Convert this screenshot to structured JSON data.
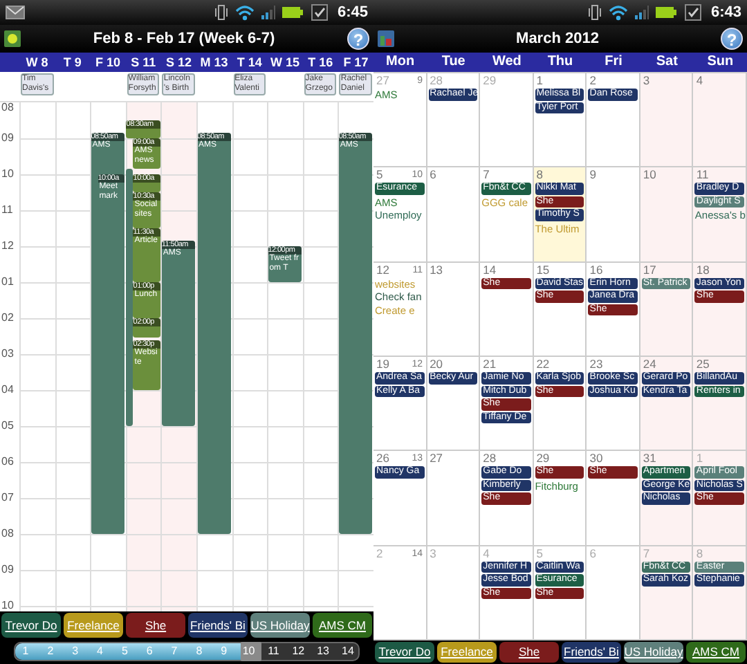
{
  "screens": [
    {
      "kind": "week",
      "status_bar": {
        "time": "6:45",
        "notifications": [
          {
            "kind": "mail"
          }
        ]
      },
      "title_bar": {
        "title": "Feb 8 - Feb 17 (Week 6-7)",
        "help": "?"
      },
      "week_view": {
        "days": [
          {
            "label": "W 8",
            "weekend": false,
            "all_day": [
              "Tim Davis's"
            ]
          },
          {
            "label": "T 9",
            "weekend": false
          },
          {
            "label": "F 10",
            "weekend": false,
            "events": [
              {
                "time": "08:50am",
                "title": "AMS",
                "color": "#4e7b6b"
              },
              {
                "time": "10:00a",
                "title": "Meet mark",
                "color": "#4e7b6b"
              }
            ]
          },
          {
            "label": "S 11",
            "weekend": true,
            "all_day": [
              "William Forsyth"
            ],
            "events": [
              {
                "time": "08:30am",
                "color": "#6b8f3c"
              },
              {
                "color": "#4e7b6b"
              },
              {
                "time": "09:00a",
                "title": "AMS news",
                "color": "#6b8f3c"
              },
              {
                "time": "10:00a",
                "color": "#6b8f3c"
              },
              {
                "time": "10:30a",
                "title": "Social sites",
                "color": "#6b8f3c"
              },
              {
                "time": "11:30a",
                "title": "Article",
                "color": "#6b8f3c"
              },
              {
                "time": "01:00p",
                "title": "Lunch",
                "color": "#6b8f3c"
              },
              {
                "time": "02:00p",
                "color": "#6b8f3c"
              },
              {
                "time": "02:30p",
                "title": "Website",
                "color": "#6b8f3c"
              }
            ]
          },
          {
            "label": "S 12",
            "weekend": true,
            "all_day": [
              "Lincoln 's Birth"
            ],
            "events": [
              {
                "time": "11:50am",
                "title": "AMS",
                "color": "#4e7b6b"
              }
            ]
          },
          {
            "label": "M 13",
            "weekend": false,
            "events": [
              {
                "time": "08:50am",
                "title": "AMS",
                "color": "#4e7b6b"
              }
            ]
          },
          {
            "label": "T 14",
            "weekend": false,
            "all_day": [
              "Eliza Valenti"
            ]
          },
          {
            "label": "W 15",
            "weekend": false,
            "events": [
              {
                "time": "12:00pm",
                "title": "Tweet from T",
                "color": "#4e7b6b"
              }
            ]
          },
          {
            "label": "T 16",
            "weekend": false,
            "all_day": [
              "Jake Grzego"
            ]
          },
          {
            "label": "F 17",
            "weekend": false,
            "all_day": [
              "Rachel Daniel"
            ],
            "events": [
              {
                "time": "08:50am",
                "title": "AMS",
                "color": "#4e7b6b"
              }
            ]
          }
        ],
        "hours": [
          "08",
          "09",
          "10",
          "11",
          "12",
          "01",
          "02",
          "03",
          "04",
          "05",
          "06",
          "07",
          "08",
          "09",
          "10"
        ]
      },
      "legend": [
        {
          "text": "Trevor Do",
          "color": "#1d5a45"
        },
        {
          "text": "Freelance",
          "color": "#b89a1c"
        },
        {
          "text": "She",
          "color": "#7b1c1c"
        },
        {
          "text": "Friends' Bi",
          "color": "#203566"
        },
        {
          "text": "US Holiday",
          "color": "#5f807c"
        },
        {
          "text": "AMS CM",
          "color": "#2f6a1a"
        }
      ],
      "slider": {
        "ticks": [
          "1",
          "2",
          "3",
          "4",
          "5",
          "6",
          "7",
          "8",
          "9",
          "10",
          "11",
          "12",
          "13",
          "14"
        ],
        "level": 0.692
      }
    },
    {
      "kind": "month",
      "status_bar": {
        "time": "6:43"
      },
      "title_bar": {
        "title": "March 2012",
        "help": "?"
      },
      "month_view": {
        "weekdays": [
          {
            "label": "Mon",
            "weekend": false
          },
          {
            "label": "Tue",
            "weekend": false
          },
          {
            "label": "Wed",
            "weekend": false
          },
          {
            "label": "Thu",
            "weekend": false
          },
          {
            "label": "Fri",
            "weekend": false
          },
          {
            "label": "Sat",
            "weekend": true
          },
          {
            "label": "Sun",
            "weekend": true
          }
        ],
        "weeks": [
          {
            "number": "9",
            "days": [
              {
                "date": "27",
                "other_month": true,
                "today": false,
                "events": [
                  {
                    "kind": "text",
                    "text": "AMS",
                    "color": "#2f7a3a"
                  }
                ]
              },
              {
                "date": "28",
                "other_month": true,
                "today": false,
                "events": [
                  {
                    "kind": "chip",
                    "text": "Rachael Je",
                    "color": "#203566"
                  }
                ]
              },
              {
                "date": "29",
                "other_month": true,
                "today": false
              },
              {
                "date": "1",
                "other_month": false,
                "today": false,
                "events": [
                  {
                    "kind": "chip",
                    "text": "Melissa Bl",
                    "color": "#203566"
                  },
                  {
                    "kind": "chip",
                    "text": "Tyler Port",
                    "color": "#203566"
                  }
                ]
              },
              {
                "date": "2",
                "other_month": false,
                "today": false,
                "events": [
                  {
                    "kind": "chip",
                    "text": "Dan Rose",
                    "color": "#203566"
                  }
                ]
              },
              {
                "date": "3",
                "other_month": false,
                "today": false
              },
              {
                "date": "4",
                "other_month": false,
                "today": false
              }
            ]
          },
          {
            "number": "10",
            "days": [
              {
                "date": "5",
                "other_month": false,
                "today": false,
                "events": [
                  {
                    "kind": "chip",
                    "text": "Esurance",
                    "color": "#1d5e45"
                  },
                  {
                    "kind": "text",
                    "text": "AMS",
                    "color": "#2f7a3a"
                  },
                  {
                    "kind": "text",
                    "text": "Unemploy",
                    "color": "#2f6a55"
                  }
                ]
              },
              {
                "date": "6",
                "other_month": false,
                "today": false
              },
              {
                "date": "7",
                "other_month": false,
                "today": false,
                "events": [
                  {
                    "kind": "chip",
                    "text": "Fbn&t CC",
                    "color": "#1d5e45"
                  },
                  {
                    "kind": "text",
                    "text": "GGG cale",
                    "color": "#c09a30"
                  }
                ]
              },
              {
                "date": "8",
                "other_month": false,
                "today": true,
                "events": [
                  {
                    "kind": "chip",
                    "text": "Nikki Mat",
                    "color": "#203566"
                  },
                  {
                    "kind": "chip",
                    "text": "She",
                    "color": "#7b1c1c"
                  },
                  {
                    "kind": "chip",
                    "text": "Timothy S",
                    "color": "#203566"
                  },
                  {
                    "kind": "text",
                    "text": "The Ultim",
                    "color": "#c09a30"
                  }
                ]
              },
              {
                "date": "9",
                "other_month": false,
                "today": false
              },
              {
                "date": "10",
                "other_month": false,
                "today": false
              },
              {
                "date": "11",
                "other_month": false,
                "today": false,
                "events": [
                  {
                    "kind": "chip",
                    "text": "Bradley D",
                    "color": "#203566"
                  },
                  {
                    "kind": "chip",
                    "text": "Daylight S",
                    "color": "#5a807a"
                  },
                  {
                    "kind": "text",
                    "text": "Anessa's b",
                    "color": "#2f6a55"
                  }
                ]
              }
            ]
          },
          {
            "number": "11",
            "days": [
              {
                "date": "12",
                "other_month": false,
                "today": false,
                "events": [
                  {
                    "kind": "text",
                    "text": "websites",
                    "color": "#c09a30"
                  },
                  {
                    "kind": "text",
                    "text": "Check fan",
                    "color": "#2f5a4a"
                  },
                  {
                    "kind": "text",
                    "text": "Create e",
                    "color": "#c09a30"
                  }
                ]
              },
              {
                "date": "13",
                "other_month": false,
                "today": false
              },
              {
                "date": "14",
                "other_month": false,
                "today": false,
                "events": [
                  {
                    "kind": "chip",
                    "text": "She",
                    "color": "#7b1c1c"
                  }
                ]
              },
              {
                "date": "15",
                "other_month": false,
                "today": false,
                "events": [
                  {
                    "kind": "chip",
                    "text": "David Stas",
                    "color": "#203566"
                  },
                  {
                    "kind": "chip",
                    "text": "She",
                    "color": "#7b1c1c"
                  }
                ]
              },
              {
                "date": "16",
                "other_month": false,
                "today": false,
                "events": [
                  {
                    "kind": "chip",
                    "text": "Erin Horn",
                    "color": "#203566"
                  },
                  {
                    "kind": "chip",
                    "text": "Janea Dra",
                    "color": "#203566"
                  },
                  {
                    "kind": "chip",
                    "text": "She",
                    "color": "#7b1c1c"
                  }
                ]
              },
              {
                "date": "17",
                "other_month": false,
                "today": false,
                "events": [
                  {
                    "kind": "chip",
                    "text": "St. Patrick",
                    "color": "#5a807a"
                  }
                ]
              },
              {
                "date": "18",
                "other_month": false,
                "today": false,
                "events": [
                  {
                    "kind": "chip",
                    "text": "Jason Yon",
                    "color": "#203566"
                  },
                  {
                    "kind": "chip",
                    "text": "She",
                    "color": "#7b1c1c"
                  }
                ]
              }
            ]
          },
          {
            "number": "12",
            "days": [
              {
                "date": "19",
                "other_month": false,
                "today": false,
                "events": [
                  {
                    "kind": "chip",
                    "text": "Andrea Sa",
                    "color": "#203566"
                  },
                  {
                    "kind": "chip",
                    "text": "Kelly A Ba",
                    "color": "#203566"
                  }
                ]
              },
              {
                "date": "20",
                "other_month": false,
                "today": false,
                "events": [
                  {
                    "kind": "chip",
                    "text": "Becky Aur",
                    "color": "#203566"
                  }
                ]
              },
              {
                "date": "21",
                "other_month": false,
                "today": false,
                "events": [
                  {
                    "kind": "chip",
                    "text": "Jamie No",
                    "color": "#203566"
                  },
                  {
                    "kind": "chip",
                    "text": "Mitch Dub",
                    "color": "#203566"
                  },
                  {
                    "kind": "chip",
                    "text": "She",
                    "color": "#7b1c1c"
                  },
                  {
                    "kind": "chip",
                    "text": "Tiffany De",
                    "color": "#203566"
                  }
                ]
              },
              {
                "date": "22",
                "other_month": false,
                "today": false,
                "events": [
                  {
                    "kind": "chip",
                    "text": "Karla Sjob",
                    "color": "#203566"
                  },
                  {
                    "kind": "chip",
                    "text": "She",
                    "color": "#7b1c1c"
                  }
                ]
              },
              {
                "date": "23",
                "other_month": false,
                "today": false,
                "events": [
                  {
                    "kind": "chip",
                    "text": "Brooke Sc",
                    "color": "#203566"
                  },
                  {
                    "kind": "chip",
                    "text": "Joshua Ku",
                    "color": "#203566"
                  }
                ]
              },
              {
                "date": "24",
                "other_month": false,
                "today": false,
                "events": [
                  {
                    "kind": "chip",
                    "text": "Gerard Po",
                    "color": "#203566"
                  },
                  {
                    "kind": "chip",
                    "text": "Kendra Ta",
                    "color": "#203566"
                  }
                ]
              },
              {
                "date": "25",
                "other_month": false,
                "today": false,
                "events": [
                  {
                    "kind": "chip",
                    "text": "BillandAu",
                    "color": "#203566"
                  },
                  {
                    "kind": "chip",
                    "text": "Renters in",
                    "color": "#1d5e45"
                  }
                ]
              }
            ]
          },
          {
            "number": "13",
            "days": [
              {
                "date": "26",
                "other_month": false,
                "today": false,
                "events": [
                  {
                    "kind": "chip",
                    "text": "Nancy Ga",
                    "color": "#203566"
                  }
                ]
              },
              {
                "date": "27",
                "other_month": false,
                "today": false
              },
              {
                "date": "28",
                "other_month": false,
                "today": false,
                "events": [
                  {
                    "kind": "chip",
                    "text": "Gabe Do",
                    "color": "#203566"
                  },
                  {
                    "kind": "chip",
                    "text": "Kimberly",
                    "color": "#203566"
                  },
                  {
                    "kind": "chip",
                    "text": "She",
                    "color": "#7b1c1c"
                  }
                ]
              },
              {
                "date": "29",
                "other_month": false,
                "today": false,
                "events": [
                  {
                    "kind": "chip",
                    "text": "She",
                    "color": "#7b1c1c"
                  },
                  {
                    "kind": "text",
                    "text": "Fitchburg",
                    "color": "#2f7a3a"
                  }
                ]
              },
              {
                "date": "30",
                "other_month": false,
                "today": false,
                "events": [
                  {
                    "kind": "chip",
                    "text": "She",
                    "color": "#7b1c1c"
                  }
                ]
              },
              {
                "date": "31",
                "other_month": false,
                "today": false,
                "events": [
                  {
                    "kind": "chip",
                    "text": "Apartmen",
                    "color": "#1d5e45"
                  },
                  {
                    "kind": "chip",
                    "text": "George Ke",
                    "color": "#203566"
                  },
                  {
                    "kind": "chip",
                    "text": "Nicholas",
                    "color": "#203566"
                  }
                ]
              },
              {
                "date": "1",
                "other_month": true,
                "today": false,
                "events": [
                  {
                    "kind": "chip",
                    "text": "April Fool",
                    "color": "#5a807a"
                  },
                  {
                    "kind": "chip",
                    "text": "Nicholas S",
                    "color": "#203566"
                  },
                  {
                    "kind": "chip",
                    "text": "She",
                    "color": "#7b1c1c"
                  }
                ]
              }
            ]
          },
          {
            "number": "14",
            "days": [
              {
                "date": "2",
                "other_month": true,
                "today": false
              },
              {
                "date": "3",
                "other_month": true,
                "today": false
              },
              {
                "date": "4",
                "other_month": true,
                "today": false,
                "events": [
                  {
                    "kind": "chip",
                    "text": "Jennifer H",
                    "color": "#203566"
                  },
                  {
                    "kind": "chip",
                    "text": "Jesse Bod",
                    "color": "#203566"
                  },
                  {
                    "kind": "chip",
                    "text": "She",
                    "color": "#7b1c1c"
                  }
                ]
              },
              {
                "date": "5",
                "other_month": true,
                "today": false,
                "events": [
                  {
                    "kind": "chip",
                    "text": "Caitlin Wa",
                    "color": "#203566"
                  },
                  {
                    "kind": "chip",
                    "text": "Esurance",
                    "color": "#1d5e45"
                  },
                  {
                    "kind": "chip",
                    "text": "She",
                    "color": "#7b1c1c"
                  }
                ]
              },
              {
                "date": "6",
                "other_month": true,
                "today": false
              },
              {
                "date": "7",
                "other_month": true,
                "today": false,
                "events": [
                  {
                    "kind": "chip",
                    "text": "Fbn&t CC",
                    "color": "#3f6f62"
                  },
                  {
                    "kind": "chip",
                    "text": "Sarah Koz",
                    "color": "#203566"
                  }
                ]
              },
              {
                "date": "8",
                "other_month": true,
                "today": false,
                "events": [
                  {
                    "kind": "chip",
                    "text": "Easter",
                    "color": "#5a807a"
                  },
                  {
                    "kind": "chip",
                    "text": "Stephanie",
                    "color": "#203566"
                  }
                ]
              }
            ]
          }
        ]
      },
      "legend": [
        {
          "text": "Trevor Do",
          "color": "#1d5a45"
        },
        {
          "text": "Freelance",
          "color": "#b89a1c"
        },
        {
          "text": "She",
          "color": "#7b1c1c"
        },
        {
          "text": "Friends' Bi",
          "color": "#203566"
        },
        {
          "text": "US Holiday",
          "color": "#5f807c"
        },
        {
          "text": "AMS CM",
          "color": "#2f6a1a"
        }
      ]
    }
  ]
}
